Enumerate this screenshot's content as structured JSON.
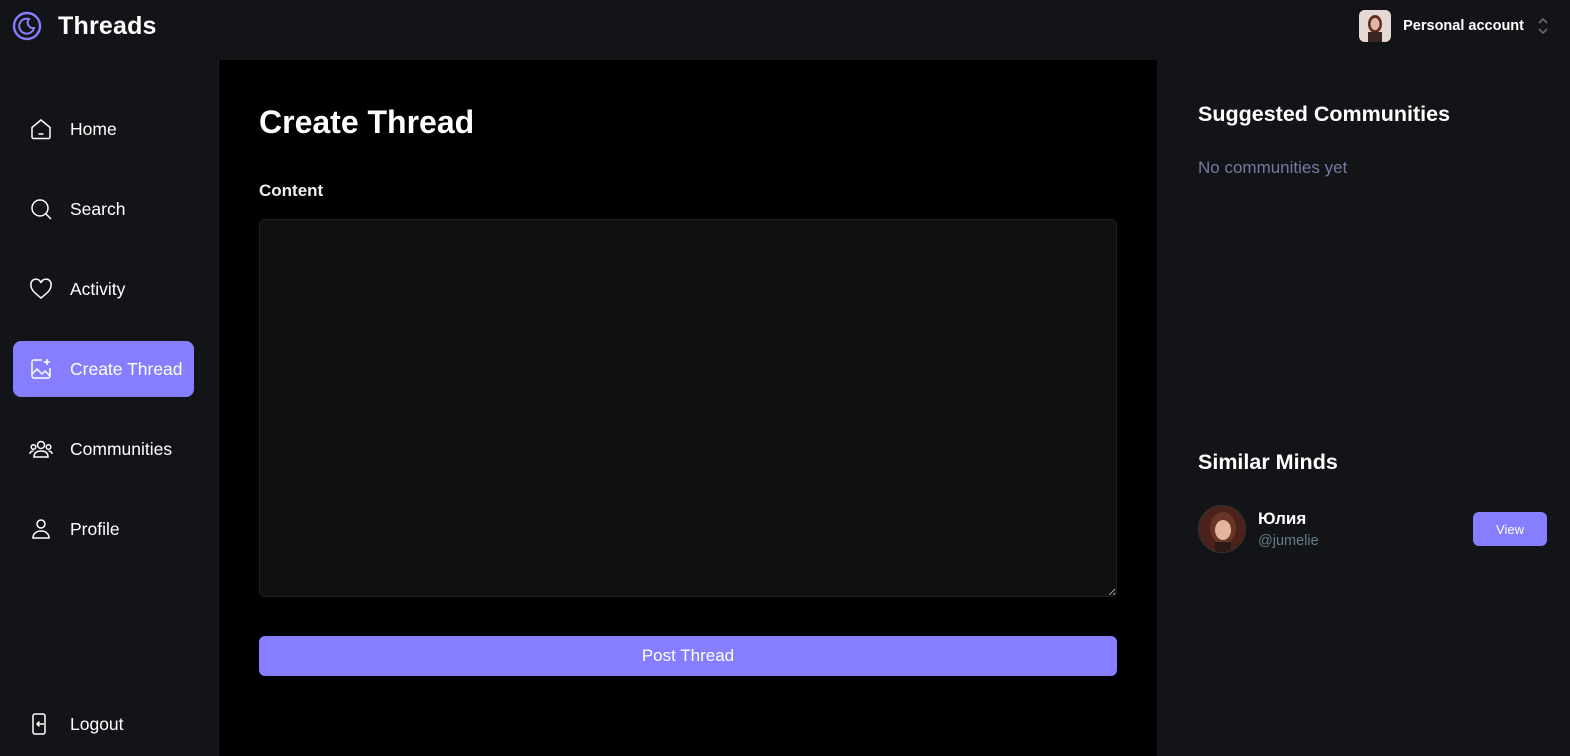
{
  "app": {
    "title": "Threads"
  },
  "account": {
    "label": "Personal account"
  },
  "sidebar": {
    "items": [
      {
        "label": "Home",
        "icon": "home-icon"
      },
      {
        "label": "Search",
        "icon": "search-icon"
      },
      {
        "label": "Activity",
        "icon": "heart-icon"
      },
      {
        "label": "Create Thread",
        "icon": "image-plus-icon",
        "active": true
      },
      {
        "label": "Communities",
        "icon": "users-icon"
      },
      {
        "label": "Profile",
        "icon": "user-icon"
      }
    ],
    "logout_label": "Logout"
  },
  "main": {
    "title": "Create Thread",
    "content_label": "Content",
    "content_value": "",
    "post_label": "Post Thread"
  },
  "right": {
    "communities_title": "Suggested Communities",
    "communities_empty": "No communities yet",
    "minds_title": "Similar Minds",
    "users": [
      {
        "name": "Юлия",
        "handle": "@jumelie",
        "action": "View"
      }
    ]
  },
  "colors": {
    "accent": "#877eff",
    "background": "#121417",
    "main_bg": "#000000",
    "muted": "#7878a3"
  }
}
